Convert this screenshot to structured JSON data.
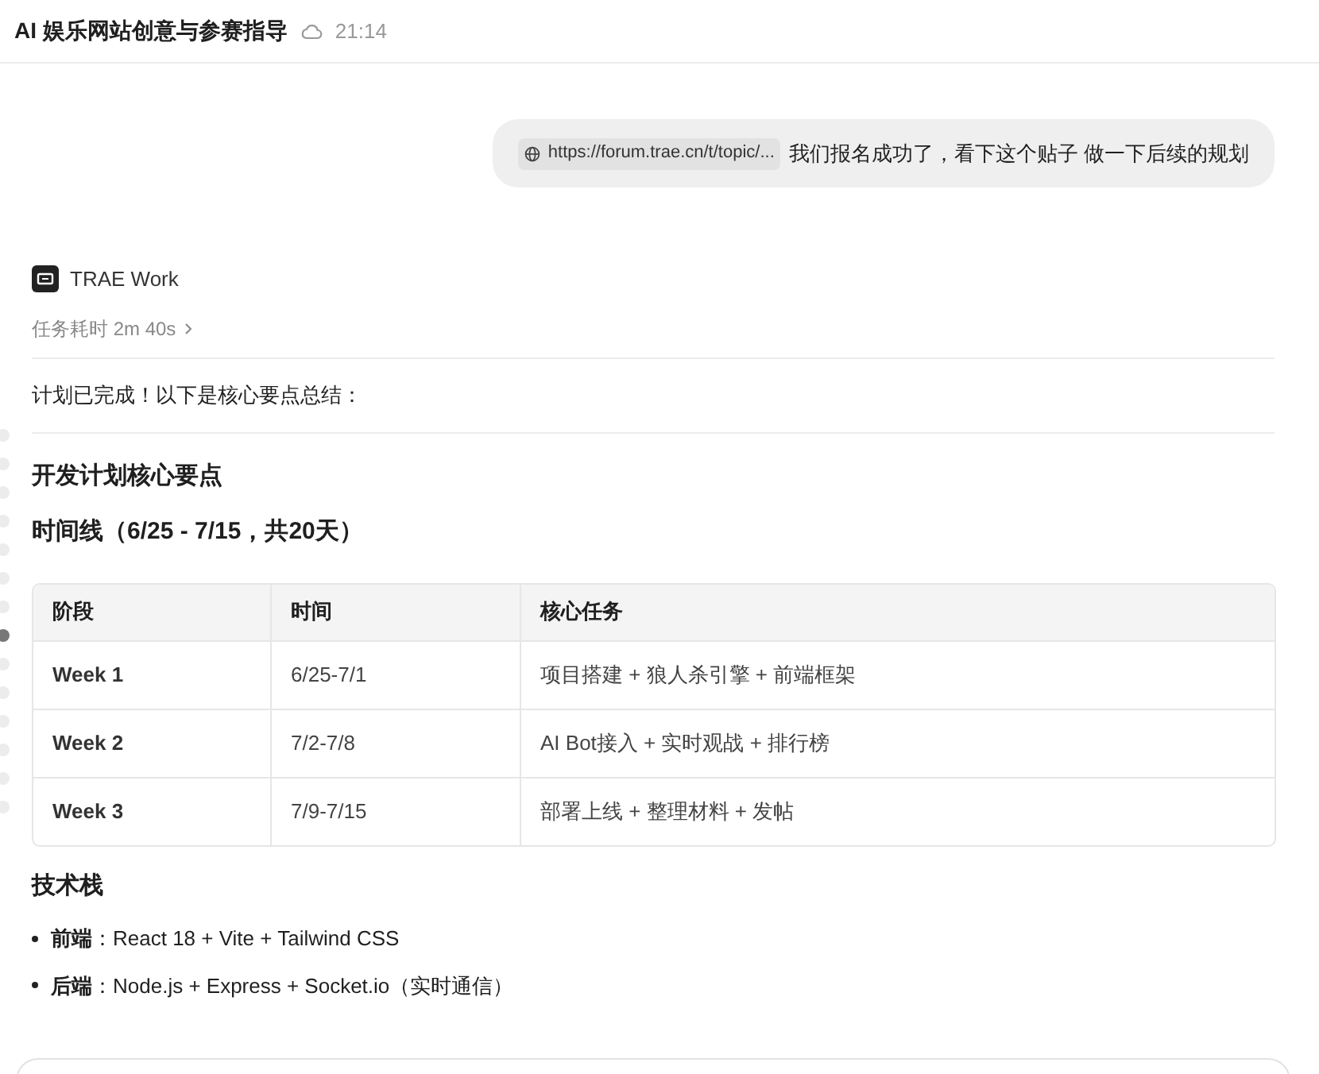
{
  "header": {
    "title": "AI 娱乐网站创意与参赛指导",
    "time": "21:14"
  },
  "user_message": {
    "link": "https://forum.trae.cn/t/topic/...",
    "text": "我们报名成功了，看下这个贴子 做一下后续的规划"
  },
  "assistant": {
    "name": "TRAE Work",
    "duration": "任务耗时 2m 40s",
    "intro": "计划已完成！以下是核心要点总结：",
    "heading": "开发计划核心要点",
    "subheading": "时间线（6/25 - 7/15，共20天）",
    "table": {
      "columns": [
        "阶段",
        "时间",
        "核心任务"
      ],
      "rows": [
        [
          "Week 1",
          "6/25-7/1",
          "项目搭建 + 狼人杀引擎 + 前端框架"
        ],
        [
          "Week 2",
          "7/2-7/8",
          "AI Bot接入 + 实时观战 + 排行榜"
        ],
        [
          "Week 3",
          "7/9-7/15",
          "部署上线 + 整理材料 + 发帖"
        ]
      ]
    },
    "section_title": "技术栈",
    "bullets": [
      "**前端**：React 18 + Vite + Tailwind CSS",
      "**后端**：Node.js + Express + Socket.io（实时通信）"
    ]
  },
  "nav_dots": [
    {
      "selected": false
    },
    {
      "selected": false
    },
    {
      "selected": false
    },
    {
      "selected": false
    },
    {
      "selected": false
    },
    {
      "selected": false
    },
    {
      "selected": false
    },
    {
      "selected": true
    },
    {
      "selected": false
    },
    {
      "selected": false
    },
    {
      "selected": false
    },
    {
      "selected": false
    },
    {
      "selected": false
    },
    {
      "selected": false
    }
  ]
}
